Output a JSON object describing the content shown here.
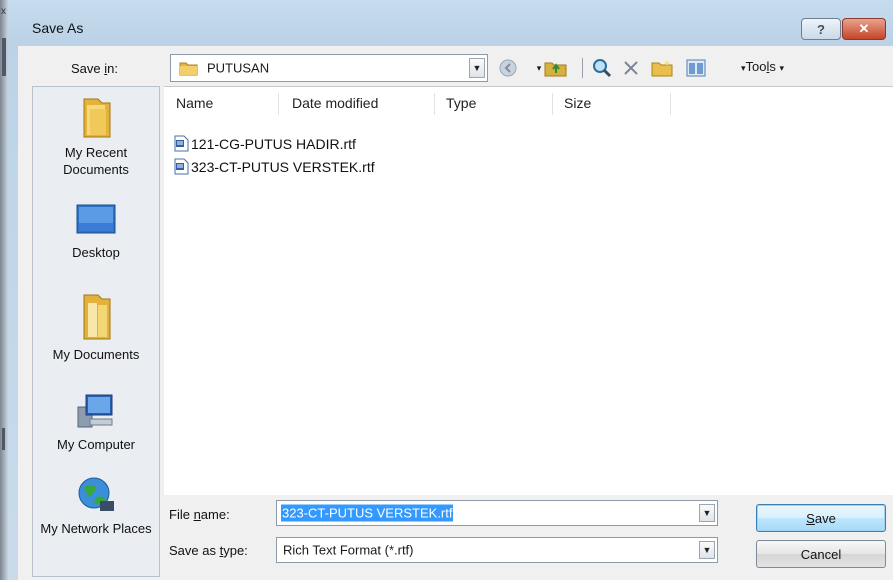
{
  "window": {
    "title": "Save As",
    "help_label": "?",
    "close_label": "✕",
    "edge_mark": "x"
  },
  "toolbar": {
    "save_in_label": "Save in:",
    "save_in_accel": "i",
    "location": "PUTUSAN",
    "tools_label": "Tools",
    "tools_accel": "l",
    "icons": [
      "back-icon",
      "up-folder-icon",
      "search-web-icon",
      "delete-icon",
      "new-folder-icon",
      "views-icon",
      "tools-menu-icon"
    ]
  },
  "places": [
    {
      "label": "My Recent Documents",
      "icon": "recent-documents-icon"
    },
    {
      "label": "Desktop",
      "icon": "desktop-icon"
    },
    {
      "label": "My Documents",
      "icon": "my-documents-icon"
    },
    {
      "label": "My Computer",
      "icon": "my-computer-icon"
    },
    {
      "label": "My Network Places",
      "icon": "network-places-icon"
    }
  ],
  "file_list": {
    "columns": [
      "Name",
      "Date modified",
      "Type",
      "Size"
    ],
    "files": [
      {
        "name": "121-CG-PUTUS HADIR.rtf",
        "icon": "rtf-document-icon"
      },
      {
        "name": "323-CT-PUTUS VERSTEK.rtf",
        "icon": "rtf-document-icon"
      }
    ]
  },
  "form": {
    "file_name_label": "File name:",
    "file_name_accel": "n",
    "file_name_value": "323-CT-PUTUS VERSTEK.rtf",
    "save_as_type_label": "Save as type:",
    "save_as_type_accel": "t",
    "save_as_type_value": "Rich Text Format (*.rtf)"
  },
  "buttons": {
    "save_label": "Save",
    "save_accel": "S",
    "cancel_label": "Cancel"
  },
  "colors": {
    "selection": "#3399ff",
    "title_gradient": "#c6dcee",
    "close_button": "#c5452a"
  }
}
